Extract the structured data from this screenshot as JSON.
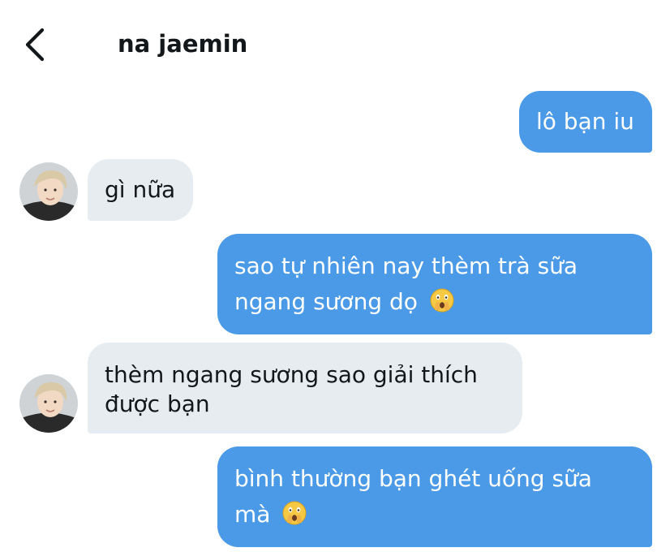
{
  "header": {
    "back_icon": "chevron-left-icon",
    "title": "na jaemin"
  },
  "messages": [
    {
      "side": "sent",
      "lines": [
        "lô bạn iu"
      ]
    },
    {
      "side": "received",
      "lines": [
        "gì nữa"
      ]
    },
    {
      "side": "sent",
      "lines": [
        "sao tự nhiên nay thèm trà sữa",
        "ngang sương dọ"
      ],
      "emoji": "face-with-open-eyes-and-hand-over-mouth"
    },
    {
      "side": "received",
      "lines": [
        "thèm ngang sương sao giải thích",
        "được bạn"
      ]
    },
    {
      "side": "sent",
      "lines": [
        "bình thường bạn ghét uống sữa",
        "mà"
      ],
      "emoji": "face-with-open-eyes-and-hand-over-mouth"
    }
  ],
  "colors": {
    "sent_bubble": "#4a9ae8",
    "received_bubble": "#e6ecf0",
    "title_text": "#14171a"
  }
}
